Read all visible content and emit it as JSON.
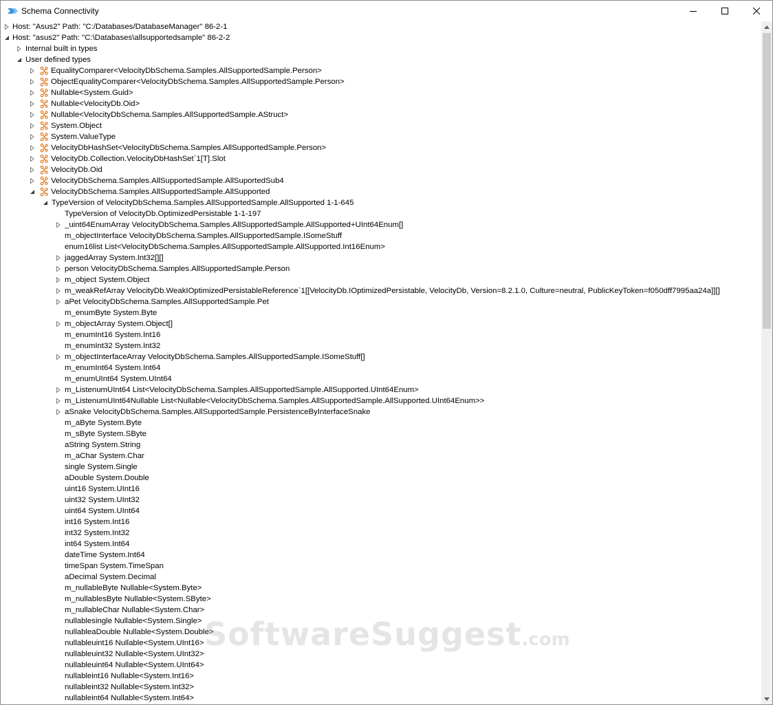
{
  "window": {
    "title": "Schema Connectivity",
    "icon": "velocitydb-app-icon"
  },
  "titlebar_buttons": {
    "minimize": "minimize-icon",
    "maximize": "maximize-icon",
    "close": "close-icon"
  },
  "watermark": {
    "main": "SoftwareSuggest",
    "suffix": ".com"
  },
  "tree": [
    {
      "depth": 0,
      "exp": "collapsed",
      "icon": false,
      "text": "Host: \"Asus2\" Path: \"C:/Databases/DatabaseManager\" 86-2-1"
    },
    {
      "depth": 0,
      "exp": "expanded",
      "icon": false,
      "text": "Host: \"asus2\" Path: \"C:\\Databases\\allsupportedsample\" 86-2-2"
    },
    {
      "depth": 1,
      "exp": "collapsed",
      "icon": false,
      "text": "Internal built in types"
    },
    {
      "depth": 1,
      "exp": "expanded",
      "icon": false,
      "text": "User defined types"
    },
    {
      "depth": 2,
      "exp": "collapsed",
      "icon": true,
      "text": "EqualityComparer<VelocityDbSchema.Samples.AllSupportedSample.Person>"
    },
    {
      "depth": 2,
      "exp": "collapsed",
      "icon": true,
      "text": "ObjectEqualityComparer<VelocityDbSchema.Samples.AllSupportedSample.Person>"
    },
    {
      "depth": 2,
      "exp": "collapsed",
      "icon": true,
      "text": "Nullable<System.Guid>"
    },
    {
      "depth": 2,
      "exp": "collapsed",
      "icon": true,
      "text": "Nullable<VelocityDb.Oid>"
    },
    {
      "depth": 2,
      "exp": "collapsed",
      "icon": true,
      "text": "Nullable<VelocityDbSchema.Samples.AllSupportedSample.AStruct>"
    },
    {
      "depth": 2,
      "exp": "collapsed",
      "icon": true,
      "text": "System.Object"
    },
    {
      "depth": 2,
      "exp": "collapsed",
      "icon": true,
      "text": "System.ValueType"
    },
    {
      "depth": 2,
      "exp": "collapsed",
      "icon": true,
      "text": "VelocityDbHashSet<VelocityDbSchema.Samples.AllSupportedSample.Person>"
    },
    {
      "depth": 2,
      "exp": "collapsed",
      "icon": true,
      "text": "VelocityDb.Collection.VelocityDbHashSet`1[T].Slot"
    },
    {
      "depth": 2,
      "exp": "collapsed",
      "icon": true,
      "text": "VelocityDb.Oid"
    },
    {
      "depth": 2,
      "exp": "collapsed",
      "icon": true,
      "text": "VelocityDbSchema.Samples.AllSupportedSample.AllSuportedSub4"
    },
    {
      "depth": 2,
      "exp": "expanded",
      "icon": true,
      "text": "VelocityDbSchema.Samples.AllSupportedSample.AllSupported"
    },
    {
      "depth": 3,
      "exp": "expanded",
      "icon": false,
      "text": "TypeVersion of VelocityDbSchema.Samples.AllSupportedSample.AllSupported 1-1-645"
    },
    {
      "depth": 4,
      "exp": "none",
      "icon": false,
      "text": "TypeVersion of VelocityDb.OptimizedPersistable 1-1-197"
    },
    {
      "depth": 4,
      "exp": "collapsed",
      "icon": false,
      "text": "_uint64EnumArray VelocityDbSchema.Samples.AllSupportedSample.AllSupported+UInt64Enum[]"
    },
    {
      "depth": 4,
      "exp": "none",
      "icon": false,
      "text": "m_objectInterface VelocityDbSchema.Samples.AllSupportedSample.ISomeStuff"
    },
    {
      "depth": 4,
      "exp": "none",
      "icon": false,
      "text": "enum16list List<VelocityDbSchema.Samples.AllSupportedSample.AllSupported.Int16Enum>"
    },
    {
      "depth": 4,
      "exp": "collapsed",
      "icon": false,
      "text": "jaggedArray System.Int32[][]"
    },
    {
      "depth": 4,
      "exp": "collapsed",
      "icon": false,
      "text": "person VelocityDbSchema.Samples.AllSupportedSample.Person"
    },
    {
      "depth": 4,
      "exp": "collapsed",
      "icon": false,
      "text": "m_object System.Object"
    },
    {
      "depth": 4,
      "exp": "collapsed",
      "icon": false,
      "text": "m_weakRefArray VelocityDb.WeakIOptimizedPersistableReference`1[[VelocityDb.IOptimizedPersistable, VelocityDb, Version=8.2.1.0, Culture=neutral, PublicKeyToken=f050dff7995aa24a]][]"
    },
    {
      "depth": 4,
      "exp": "collapsed",
      "icon": false,
      "text": "aPet VelocityDbSchema.Samples.AllSupportedSample.Pet"
    },
    {
      "depth": 4,
      "exp": "none",
      "icon": false,
      "text": "m_enumByte System.Byte"
    },
    {
      "depth": 4,
      "exp": "collapsed",
      "icon": false,
      "text": "m_objectArray System.Object[]"
    },
    {
      "depth": 4,
      "exp": "none",
      "icon": false,
      "text": "m_enumInt16 System.Int16"
    },
    {
      "depth": 4,
      "exp": "none",
      "icon": false,
      "text": "m_enumInt32 System.Int32"
    },
    {
      "depth": 4,
      "exp": "collapsed",
      "icon": false,
      "text": "m_objectInterfaceArray VelocityDbSchema.Samples.AllSupportedSample.ISomeStuff[]"
    },
    {
      "depth": 4,
      "exp": "none",
      "icon": false,
      "text": "m_enumInt64 System.Int64"
    },
    {
      "depth": 4,
      "exp": "none",
      "icon": false,
      "text": "m_enumUInt64 System.UInt64"
    },
    {
      "depth": 4,
      "exp": "collapsed",
      "icon": false,
      "text": "m_ListenumUInt64 List<VelocityDbSchema.Samples.AllSupportedSample.AllSupported.UInt64Enum>"
    },
    {
      "depth": 4,
      "exp": "collapsed",
      "icon": false,
      "text": "m_ListenumUInt64Nullable List<Nullable<VelocityDbSchema.Samples.AllSupportedSample.AllSupported.UInt64Enum>>"
    },
    {
      "depth": 4,
      "exp": "collapsed",
      "icon": false,
      "text": "aSnake VelocityDbSchema.Samples.AllSupportedSample.PersistenceByInterfaceSnake"
    },
    {
      "depth": 4,
      "exp": "none",
      "icon": false,
      "text": "m_aByte System.Byte"
    },
    {
      "depth": 4,
      "exp": "none",
      "icon": false,
      "text": "m_sByte System.SByte"
    },
    {
      "depth": 4,
      "exp": "none",
      "icon": false,
      "text": "aString System.String"
    },
    {
      "depth": 4,
      "exp": "none",
      "icon": false,
      "text": "m_aChar System.Char"
    },
    {
      "depth": 4,
      "exp": "none",
      "icon": false,
      "text": "single System.Single"
    },
    {
      "depth": 4,
      "exp": "none",
      "icon": false,
      "text": "aDouble System.Double"
    },
    {
      "depth": 4,
      "exp": "none",
      "icon": false,
      "text": "uint16 System.UInt16"
    },
    {
      "depth": 4,
      "exp": "none",
      "icon": false,
      "text": "uint32 System.UInt32"
    },
    {
      "depth": 4,
      "exp": "none",
      "icon": false,
      "text": "uint64 System.UInt64"
    },
    {
      "depth": 4,
      "exp": "none",
      "icon": false,
      "text": "int16 System.Int16"
    },
    {
      "depth": 4,
      "exp": "none",
      "icon": false,
      "text": "int32 System.Int32"
    },
    {
      "depth": 4,
      "exp": "none",
      "icon": false,
      "text": "int64 System.Int64"
    },
    {
      "depth": 4,
      "exp": "none",
      "icon": false,
      "text": "dateTime System.Int64"
    },
    {
      "depth": 4,
      "exp": "none",
      "icon": false,
      "text": "timeSpan System.TimeSpan"
    },
    {
      "depth": 4,
      "exp": "none",
      "icon": false,
      "text": "aDecimal System.Decimal"
    },
    {
      "depth": 4,
      "exp": "none",
      "icon": false,
      "text": "m_nullableByte Nullable<System.Byte>"
    },
    {
      "depth": 4,
      "exp": "none",
      "icon": false,
      "text": "m_nullablesByte Nullable<System.SByte>"
    },
    {
      "depth": 4,
      "exp": "none",
      "icon": false,
      "text": "m_nullableChar Nullable<System.Char>"
    },
    {
      "depth": 4,
      "exp": "none",
      "icon": false,
      "text": "nullablesingle Nullable<System.Single>"
    },
    {
      "depth": 4,
      "exp": "none",
      "icon": false,
      "text": "nullableaDouble Nullable<System.Double>"
    },
    {
      "depth": 4,
      "exp": "none",
      "icon": false,
      "text": "nullableuint16 Nullable<System.UInt16>"
    },
    {
      "depth": 4,
      "exp": "none",
      "icon": false,
      "text": "nullableuint32 Nullable<System.UInt32>"
    },
    {
      "depth": 4,
      "exp": "none",
      "icon": false,
      "text": "nullableuint64 Nullable<System.UInt64>"
    },
    {
      "depth": 4,
      "exp": "none",
      "icon": false,
      "text": "nullableint16 Nullable<System.Int16>"
    },
    {
      "depth": 4,
      "exp": "none",
      "icon": false,
      "text": "nullableint32 Nullable<System.Int32>"
    },
    {
      "depth": 4,
      "exp": "none",
      "icon": false,
      "text": "nullableint64 Nullable<System.Int64>"
    }
  ]
}
